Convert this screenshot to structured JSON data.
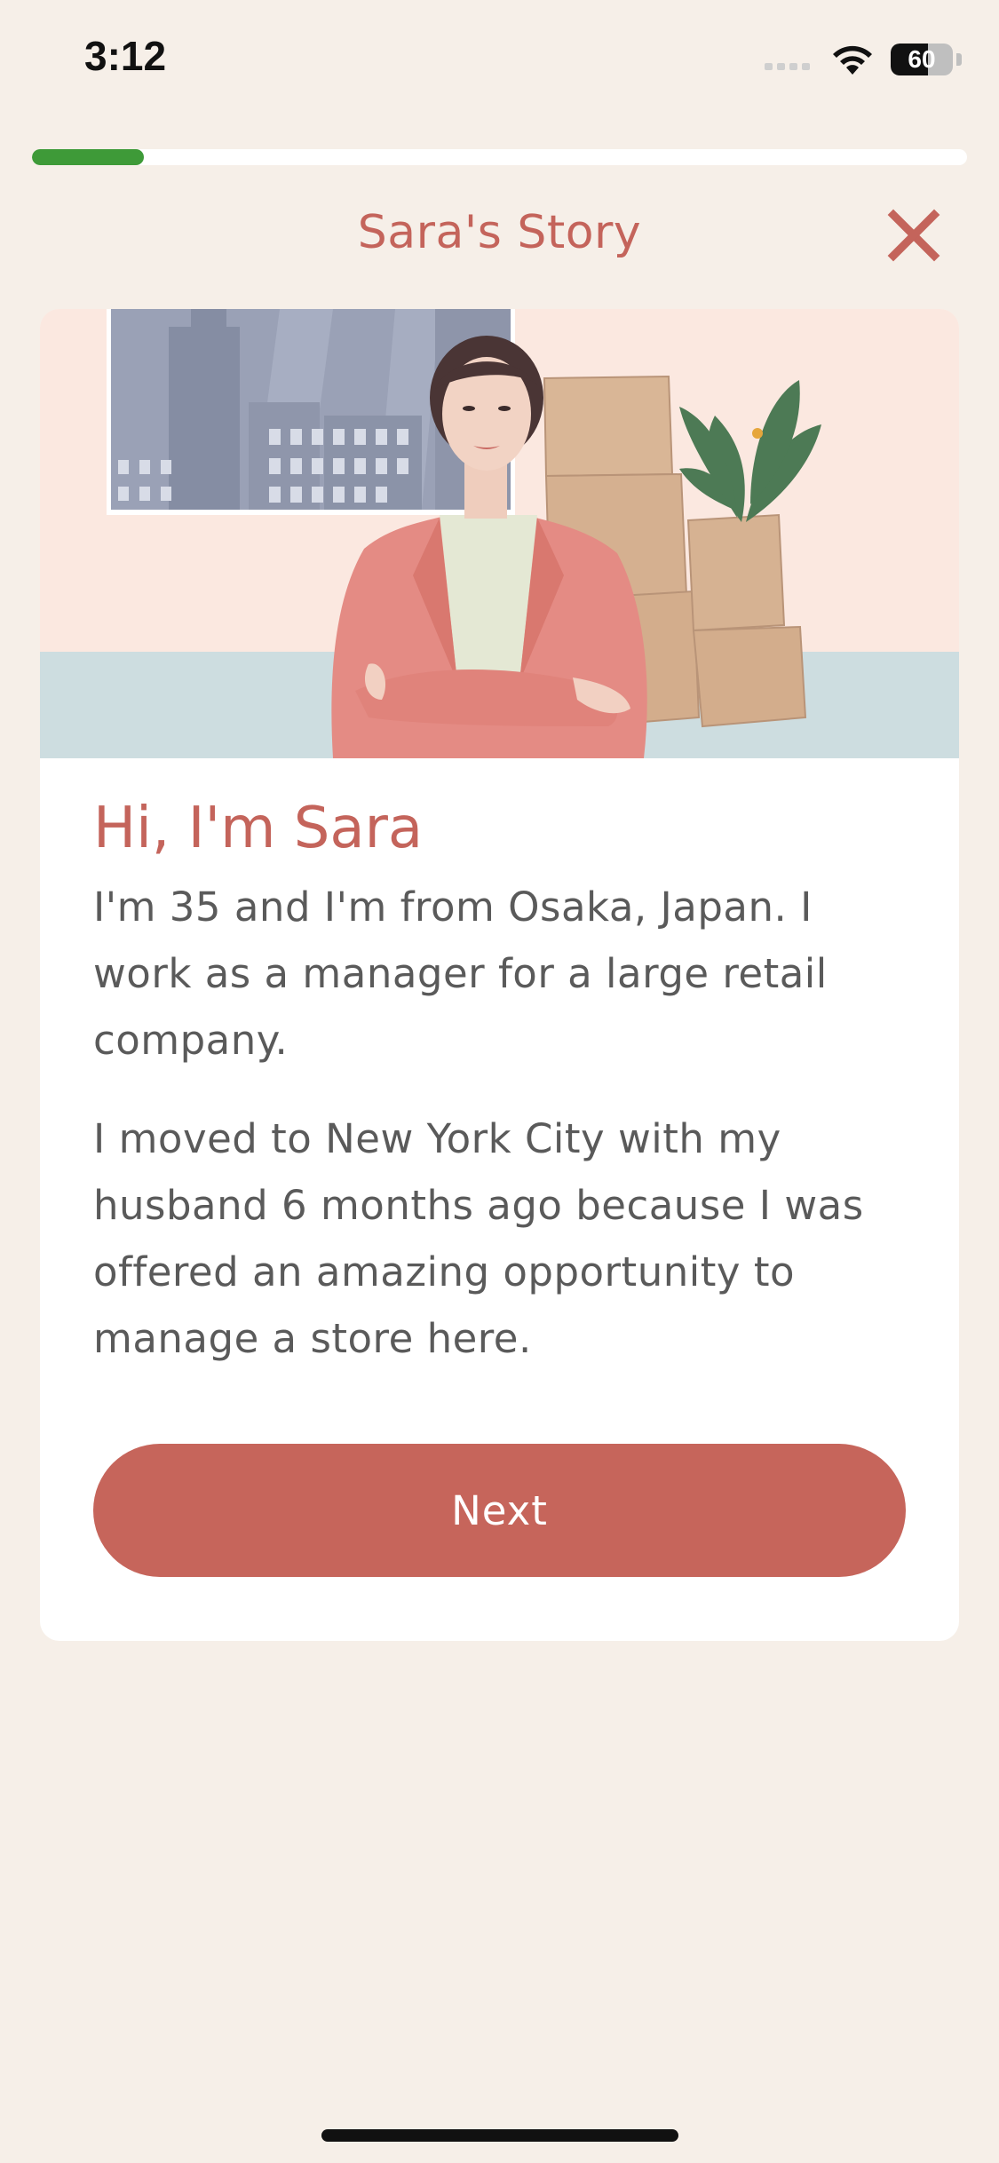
{
  "status_bar": {
    "time": "3:12",
    "battery_percent": "60",
    "battery_level": 0.6,
    "icons": [
      "signal-icon",
      "wifi-icon",
      "battery-icon"
    ]
  },
  "progress": {
    "value": 0.12,
    "color": "#3e9a38"
  },
  "header": {
    "title": "Sara's Story",
    "close_icon": "close-icon"
  },
  "story": {
    "heading": "Hi, I'm Sara",
    "paragraphs": [
      "I'm 35 and I'm from Osaka, Japan. I work as a manager for a large retail company.",
      "I moved to New York City with my husband 6 months ago because I was offered an amazing opportunity to manage a store here."
    ],
    "next_label": "Next"
  },
  "colors": {
    "accent": "#c4645b",
    "button": "#c6655b",
    "background": "#f6efe8",
    "progress": "#3e9a38"
  }
}
